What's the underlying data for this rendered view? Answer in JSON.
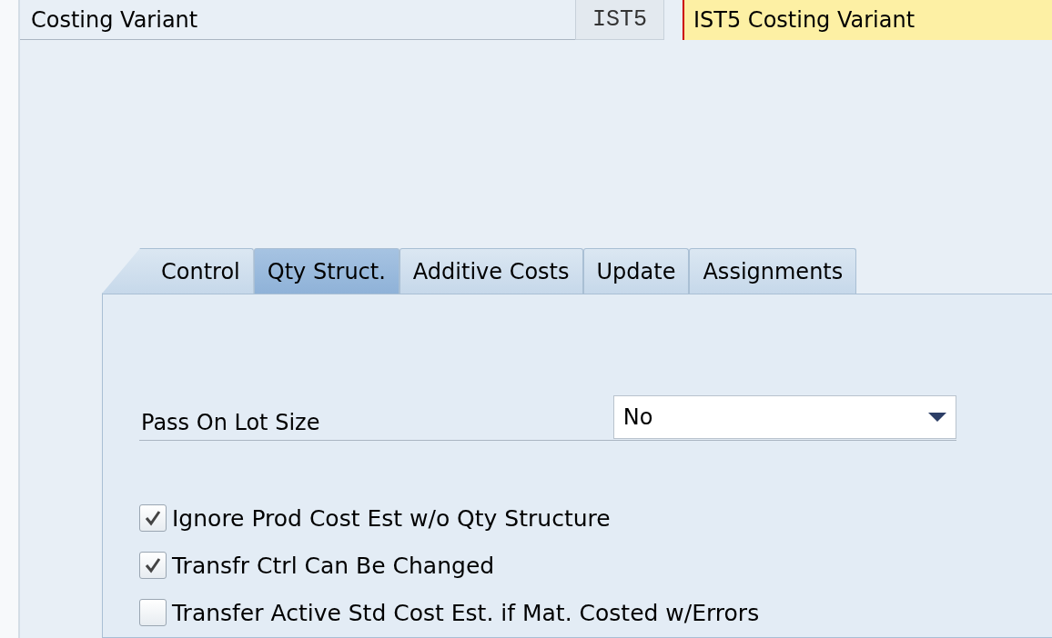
{
  "header": {
    "label": "Costing Variant",
    "code": "IST5",
    "description": "IST5 Costing Variant"
  },
  "tabs": [
    {
      "label": "Control",
      "selected": false
    },
    {
      "label": "Qty Struct.",
      "selected": true
    },
    {
      "label": "Additive Costs",
      "selected": false
    },
    {
      "label": "Update",
      "selected": false
    },
    {
      "label": "Assignments",
      "selected": false
    }
  ],
  "lot_size": {
    "label": "Pass On Lot Size",
    "value": "No"
  },
  "options": [
    {
      "label": "Ignore Prod Cost Est w/o Qty Structure",
      "checked": true
    },
    {
      "label": "Transfr Ctrl Can Be Changed",
      "checked": true
    },
    {
      "label": "Transfer Active Std Cost Est. if Mat. Costed w/Errors",
      "checked": false
    }
  ]
}
